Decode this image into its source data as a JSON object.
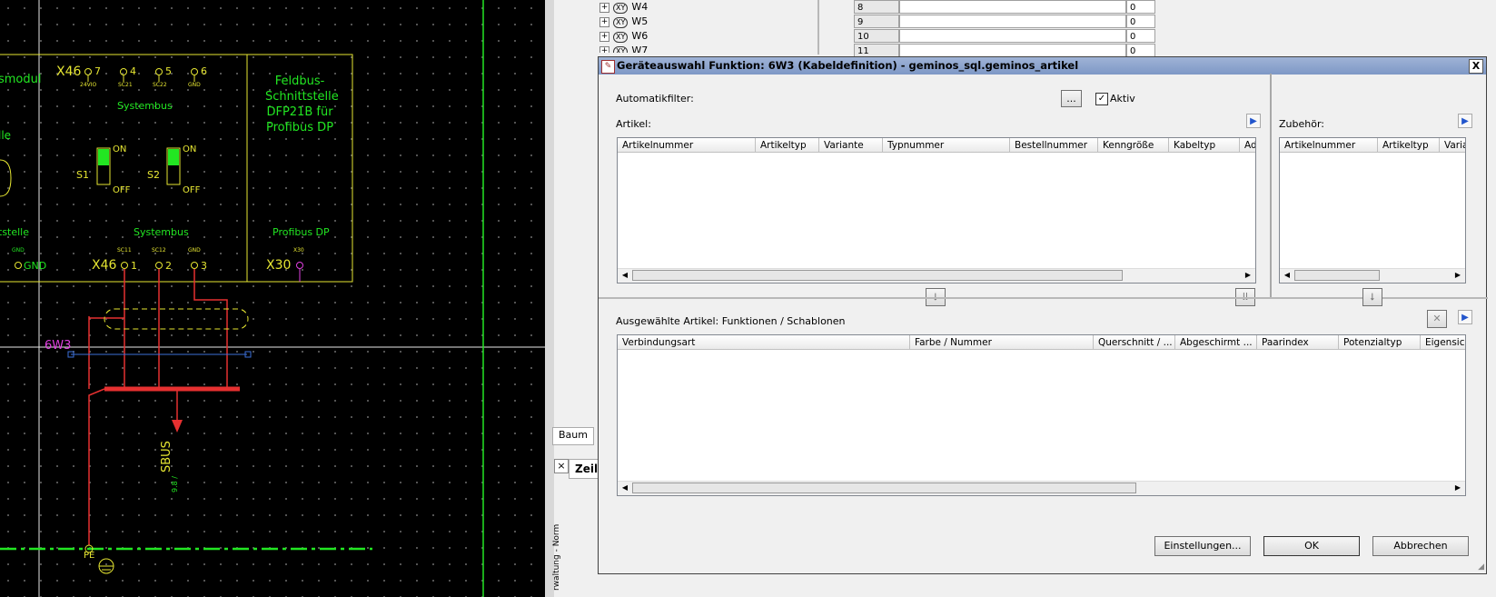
{
  "cad": {
    "label_smodul": "smodul",
    "label_lle": "lle",
    "label_tstelle": "tstelle",
    "label_gnd_left": "GND",
    "label_gnd_left_small": "GND",
    "x46_top": "X46",
    "pins_top": [
      "7",
      "4",
      "5",
      "6"
    ],
    "pins_top_small": [
      "24VIO",
      "SC21",
      "SC22",
      "GND"
    ],
    "systembus_top": "Systembus",
    "s1": "S1",
    "s2": "S2",
    "on": "ON",
    "off": "OFF",
    "systembus_bottom": "Systembus",
    "x46_bottom": "X46",
    "pins_bottom": [
      "1",
      "2",
      "3"
    ],
    "pins_bottom_small": [
      "SC11",
      "SC12",
      "GND"
    ],
    "feldbus_lines": [
      "Feldbus-",
      "Schnittstelle",
      "DFP21B für",
      "Profibus DP"
    ],
    "profibus_dp": "Profibus DP",
    "x30": "X30",
    "x30_small": "X30",
    "cable_label": "6W3",
    "sbus_label": "SBUS",
    "sbus_num": "9.8 /",
    "pe_label": "PE"
  },
  "tree": {
    "items": [
      {
        "label": "W4"
      },
      {
        "label": "W5"
      },
      {
        "label": "W6"
      },
      {
        "label": "W7"
      }
    ],
    "xy": "XY"
  },
  "grid": {
    "rows": [
      {
        "num": "8",
        "val": "0"
      },
      {
        "num": "9",
        "val": "0"
      },
      {
        "num": "10",
        "val": "0"
      },
      {
        "num": "11",
        "val": "0"
      }
    ]
  },
  "bg_tabs": {
    "baum": "Baum",
    "zeile": "Zeile",
    "vertical": "rwaltung - Norm",
    "close": "×"
  },
  "dialog": {
    "title": "Geräteauswahl Funktion: 6W3 (Kabeldefinition) - geminos_sql.geminos_artikel",
    "close": "X",
    "automatikfilter_label": "Automatikfilter:",
    "filter_button": "...",
    "aktiv_label": "Aktiv",
    "aktiv_checked": true,
    "artikel_label": "Artikel:",
    "artikel_columns": [
      "Artikelnummer",
      "Artikeltyp",
      "Variante",
      "Typnummer",
      "Bestellnummer",
      "Kenngröße",
      "Kabeltyp",
      "Ad"
    ],
    "zubehoer_label": "Zubehör:",
    "zubehoer_columns": [
      "Artikelnummer",
      "Artikeltyp",
      "Varian"
    ],
    "ausgewaehlte_label": "Ausgewählte Artikel: Funktionen / Schablonen",
    "ausgewaehlte_columns": [
      "Verbindungsart",
      "Farbe / Nummer",
      "Querschnitt / ...",
      "Abgeschirmt ...",
      "Paarindex",
      "Potenzialtyp",
      "Eigensich"
    ],
    "einstellungen": "Einstellungen...",
    "ok": "OK",
    "abbrechen": "Abbrechen",
    "colors": {
      "title_bg": "#8aa2cf",
      "accent_blue": "#2255cc"
    }
  }
}
